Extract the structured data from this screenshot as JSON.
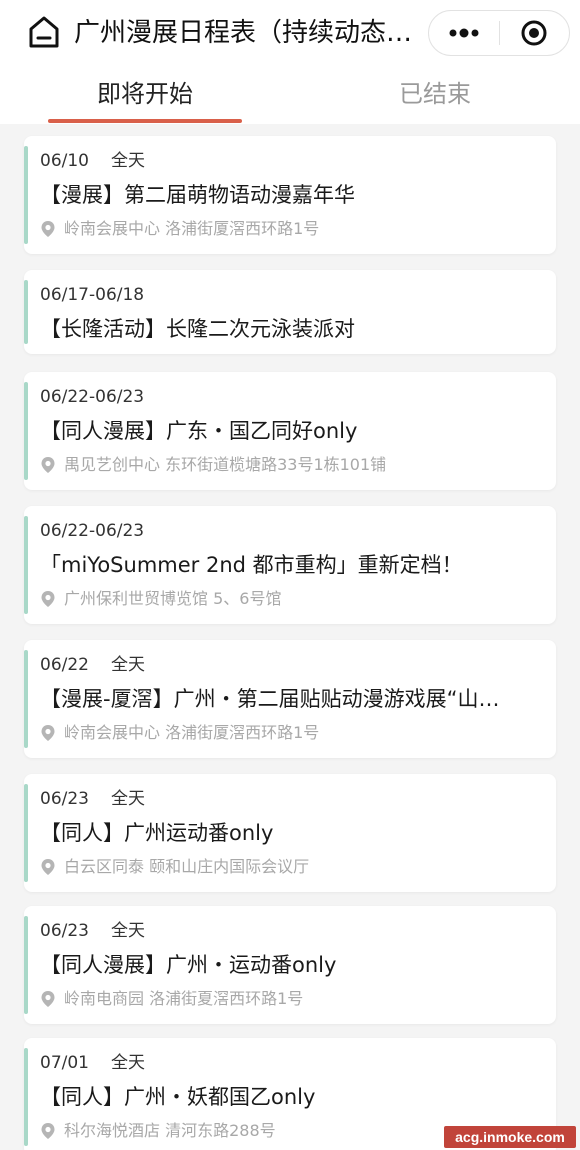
{
  "header": {
    "title": "广州漫展日程表（持续动态…",
    "home_icon": "home-icon",
    "more_icon": "more-dots-icon",
    "close_icon": "miniapp-close-icon"
  },
  "tabs": [
    {
      "label": "即将开始",
      "active": true
    },
    {
      "label": "已结束",
      "active": false
    }
  ],
  "colors": {
    "accent": "#d9604a",
    "card_bar": "#a9d8c8",
    "muted_text": "#a8a8a8"
  },
  "events": [
    {
      "date": "06/10",
      "time": "全天",
      "name": "【漫展】第二届萌物语动漫嘉年华",
      "location": "岭南会展中心 洛浦街厦滘西环路1号"
    },
    {
      "date": "06/17-06/18",
      "time": "",
      "name": "【长隆活动】长隆二次元泳装派对",
      "location": ""
    },
    {
      "date": "06/22-06/23",
      "time": "",
      "name": "【同人漫展】广东・国乙同好only",
      "location": "禺见艺创中心 东环街道榄塘路33号1栋101铺"
    },
    {
      "date": "06/22-06/23",
      "time": "",
      "name": "「miYoSummer 2nd 都市重构」重新定档！",
      "location": "广州保利世贸博览馆 5、6号馆"
    },
    {
      "date": "06/22",
      "time": "全天",
      "name": "【漫展-厦滘】广州・第二届贴贴动漫游戏展“山…",
      "location": "岭南会展中心 洛浦街厦滘西环路1号"
    },
    {
      "date": "06/23",
      "time": "全天",
      "name": "【同人】广州运动番only",
      "location": "白云区同泰 颐和山庄内国际会议厅"
    },
    {
      "date": "06/23",
      "time": "全天",
      "name": "【同人漫展】广州・运动番only",
      "location": "岭南电商园 洛浦街夏滘西环路1号"
    },
    {
      "date": "07/01",
      "time": "全天",
      "name": "【同人】广州・妖都国乙only",
      "location": "科尔海悦酒店 清河东路288号"
    }
  ],
  "watermark": "acg.inmoke.com"
}
